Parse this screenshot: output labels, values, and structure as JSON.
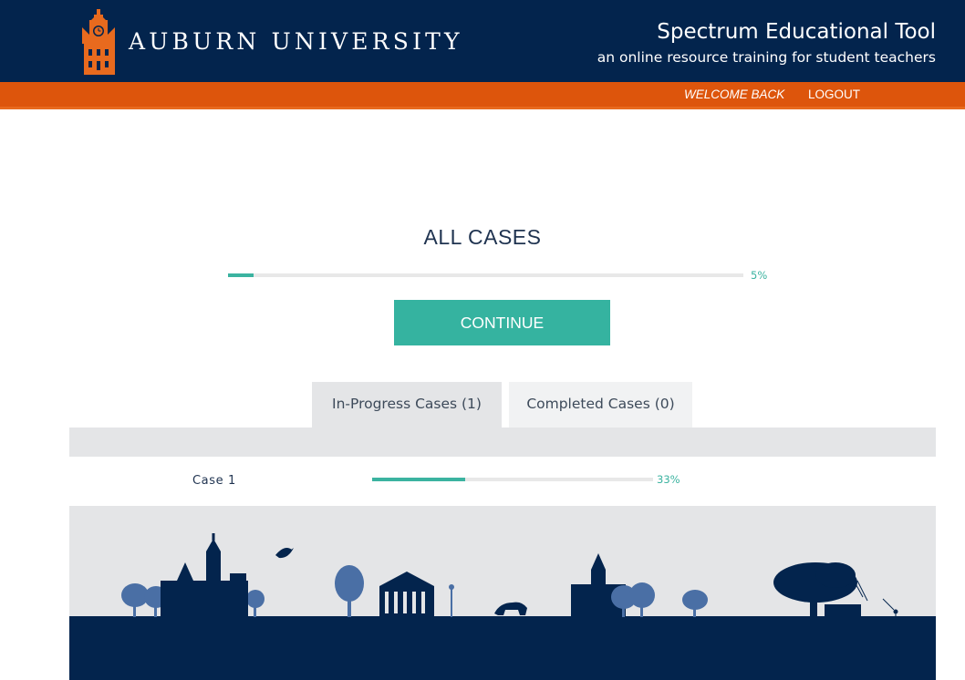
{
  "header": {
    "logo_text": "AUBURN UNIVERSITY",
    "app_title": "Spectrum Educational Tool",
    "app_subtitle": "an online resource training for student teachers"
  },
  "nav": {
    "welcome_text": "WELCOME BACK",
    "logout_label": "LOGOUT"
  },
  "main": {
    "heading": "ALL CASES",
    "overall_progress": {
      "percent": 5,
      "label": "5%"
    },
    "continue_label": "CONTINUE",
    "tabs": [
      {
        "label": "In-Progress Cases (1)",
        "active": true
      },
      {
        "label": "Completed Cases (0)",
        "active": false
      }
    ],
    "cases": [
      {
        "name": "Case 1",
        "percent": 33,
        "label": "33%"
      }
    ]
  },
  "colors": {
    "navy": "#03244d",
    "orange": "#dd550c",
    "teal": "#35b3a0",
    "silhouette_light": "#4a6fa5",
    "sky": "#e4e5e7"
  },
  "icons": [
    "clock-tower-logo-icon"
  ]
}
